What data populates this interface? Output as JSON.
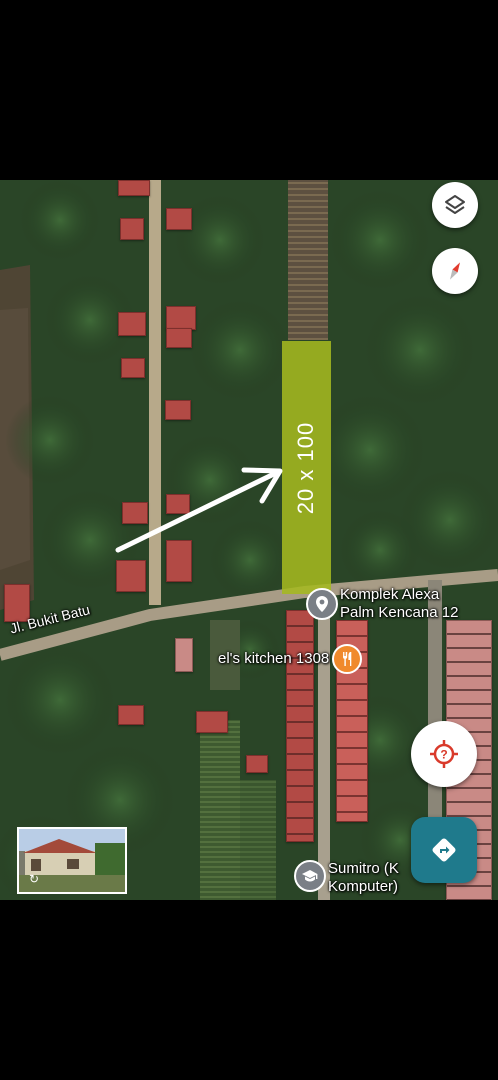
{
  "map": {
    "plot_annotation": "20 x 100",
    "road_name": "Jl. Bukit Batu",
    "places": [
      {
        "name": "Komplek Alexa\nPalm Kencana 12",
        "icon": "location-pin-icon"
      },
      {
        "name": "el's kitchen 1308",
        "icon": "restaurant-icon"
      },
      {
        "name": "Sumitro (K\nKomputer)",
        "icon": "school-icon"
      }
    ],
    "controls": [
      "layers-icon",
      "compass-icon",
      "location-icon",
      "directions-icon"
    ],
    "colors": {
      "plot_highlight": "#a4b820",
      "restaurant_marker": "#f08a2c",
      "directions_button": "#1f7a8c",
      "location_icon": "#d93a2b"
    }
  }
}
